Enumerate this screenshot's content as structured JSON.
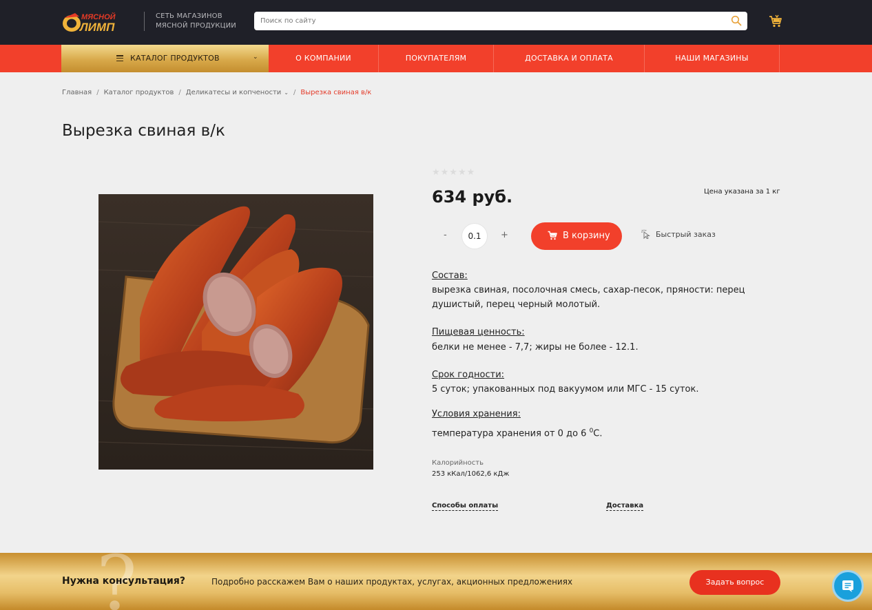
{
  "header": {
    "logo_text": "МЯСНОЙ ОЛИМП",
    "tagline_line1": "СЕТЬ МАГАЗИНОВ",
    "tagline_line2": "МЯСНОЙ ПРОДУКЦИИ",
    "search_placeholder": "Поиск по сайту",
    "icons": {
      "search": "search-icon",
      "cart": "cart-icon"
    }
  },
  "nav": {
    "catalog_label": "КАТАЛОГ ПРОДУКТОВ",
    "items": [
      {
        "label": "О КОМПАНИИ"
      },
      {
        "label": "ПОКУПАТЕЛЯМ"
      },
      {
        "label": "ДОСТАВКА И ОПЛАТА"
      },
      {
        "label": "НАШИ МАГАЗИНЫ"
      }
    ]
  },
  "breadcrumb": {
    "items": [
      "Главная",
      "Каталог продуктов",
      "Деликатесы и копчености",
      "Вырезка свиная в/к"
    ],
    "separator": "/"
  },
  "product": {
    "title": "Вырезка свиная в/к",
    "rating": 0,
    "rating_max": 5,
    "price": "634 руб.",
    "price_note": "Цена указана за 1 кг",
    "quantity": "0.1",
    "minus_label": "-",
    "plus_label": "+",
    "cart_button": "В корзину",
    "quick_order": "Быстрый заказ",
    "composition_h": "Состав:",
    "composition": "вырезка свиная, посолочная смесь, сахар-песок, пряности: перец душистый, перец черный молотый.",
    "nutrition_h": "Пищевая ценность:",
    "nutrition": "белки не менее - 7,7; жиры не более - 12.1.",
    "shelf_h": "Срок годности:",
    "shelf": "5 суток; упакованных под вакуумом или МГС - 15 суток.",
    "storage_h": "Условия хранения:",
    "storage_prefix": "температура хранения от 0 до 6 ",
    "storage_sup": "0",
    "storage_suffix": "С.",
    "calories_h": "Калорийность",
    "calories": "253 кКал/1062,6 кДж",
    "payment_link": "Способы оплаты",
    "delivery_link": "Доставка"
  },
  "consult": {
    "heading": "Нужна консультация?",
    "text": "Подробно расскажем Вам о наших продуктах, услугах, акционных предложениях",
    "button": "Задать вопрос"
  },
  "colors": {
    "accent": "#f2402b",
    "header_bg": "#1f2028",
    "gold": "#d8a94a",
    "chat": "#1aa0dc"
  }
}
